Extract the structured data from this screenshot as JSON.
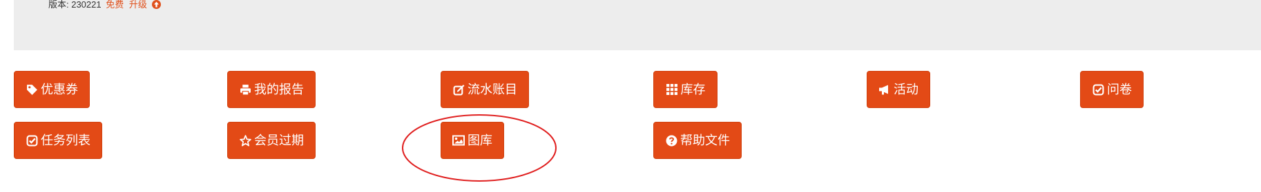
{
  "version": {
    "label": "版本: 230221",
    "free": "免费",
    "upgrade": "升级"
  },
  "buttons": [
    {
      "label": "优惠券",
      "icon": "tag-icon"
    },
    {
      "label": "我的报告",
      "icon": "print-icon"
    },
    {
      "label": "流水账目",
      "icon": "edit-icon"
    },
    {
      "label": "库存",
      "icon": "grid-icon"
    },
    {
      "label": "活动",
      "icon": "bullhorn-icon"
    },
    {
      "label": "问卷",
      "icon": "check-square-icon"
    },
    {
      "label": "任务列表",
      "icon": "check-square-icon"
    },
    {
      "label": "会员过期",
      "icon": "star-icon"
    },
    {
      "label": "图库",
      "icon": "image-icon"
    },
    {
      "label": "帮助文件",
      "icon": "question-circle-icon"
    }
  ],
  "colors": {
    "button_bg": "#e34a16",
    "panel_bg": "#ededed",
    "accent": "#e0511d",
    "annotation": "#e02020"
  }
}
